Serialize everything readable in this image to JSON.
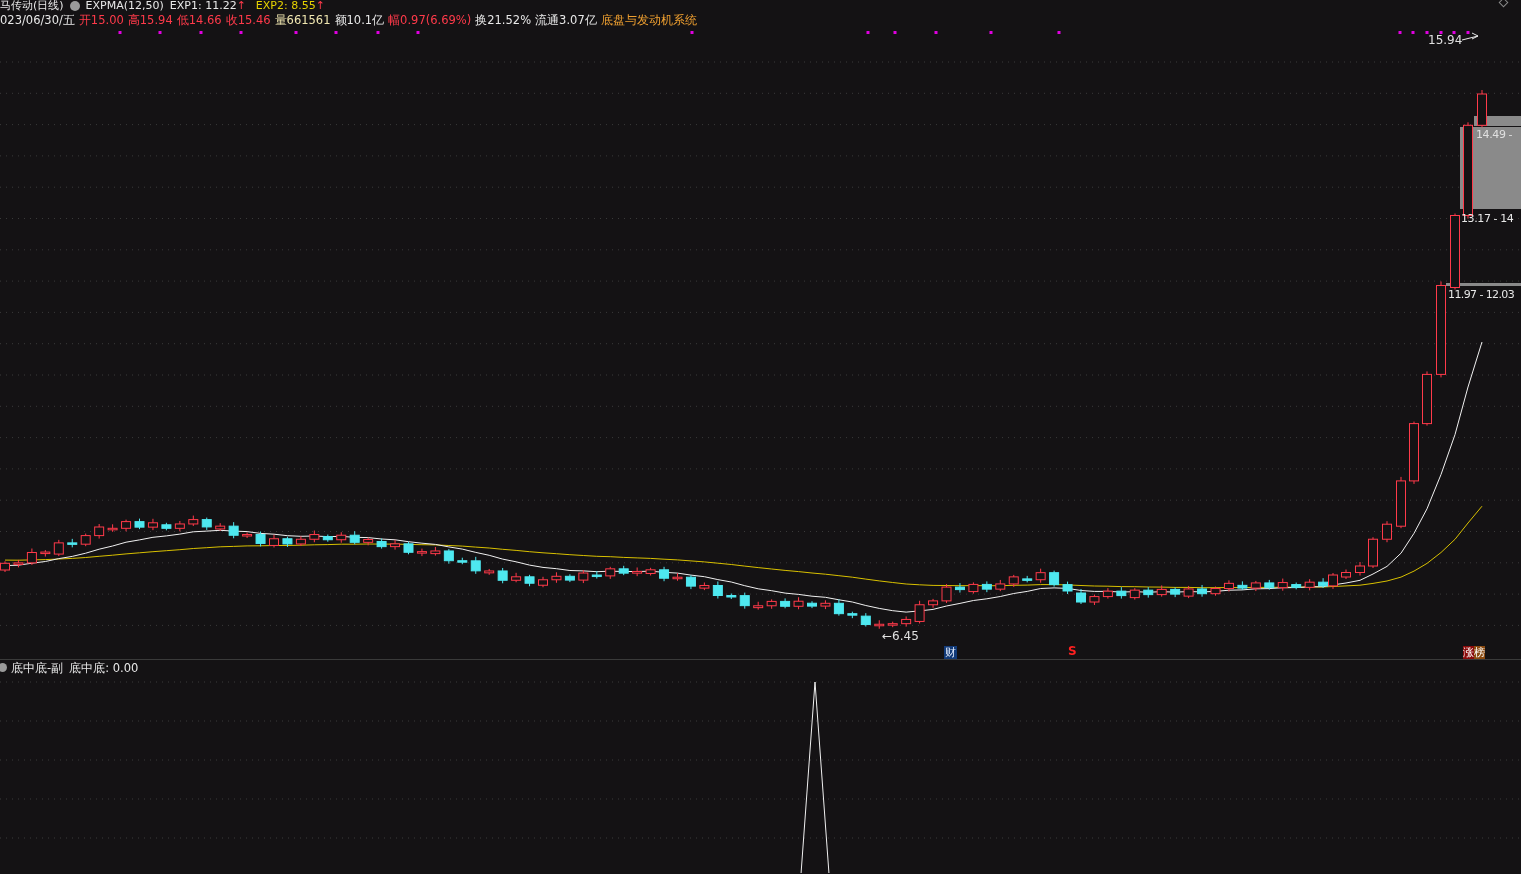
{
  "header": {
    "title": "马传动(日线)",
    "indicator": "EXPMA(12,50)",
    "values": [
      {
        "text": "EXP1: 11.22",
        "color": "#e8e8e8"
      },
      {
        "text": "EXP2: 8.55",
        "color": "#e6d200"
      }
    ],
    "arrow": "↑"
  },
  "quote": [
    {
      "text": "023/06/30/五",
      "color": "#e8e8e8"
    },
    {
      "text": "开15.00",
      "color": "#ff3a4a"
    },
    {
      "text": "高15.94",
      "color": "#ff3a4a"
    },
    {
      "text": "低14.66",
      "color": "#ff3a4a"
    },
    {
      "text": "收15.46",
      "color": "#ff3a4a"
    },
    {
      "text": "量661561",
      "color": "#f0e6b0"
    },
    {
      "text": "额10.1亿",
      "color": "#e8e8e8"
    },
    {
      "text": "幅0.97(6.69%)",
      "color": "#ff3a4a"
    },
    {
      "text": "换21.52%",
      "color": "#e8e8e8"
    },
    {
      "text": "流通3.07亿",
      "color": "#e8e8e8"
    },
    {
      "text": "底盘与发动机系统",
      "color": "#f0a030"
    }
  ],
  "price_labels": {
    "high": "15.94",
    "low": "←6.45"
  },
  "chip_labels": [
    "14.49 -",
    "13.17 - 14",
    "11.97 - 12.03"
  ],
  "markers": [
    {
      "kind": "finance",
      "text": "财"
    },
    {
      "kind": "signal",
      "text": "S"
    },
    {
      "kind": "limit",
      "parts": [
        "涨",
        "榜"
      ]
    }
  ],
  "sub_panel": {
    "title": "底中底-副",
    "reading": "底中底: 0.00"
  }
}
